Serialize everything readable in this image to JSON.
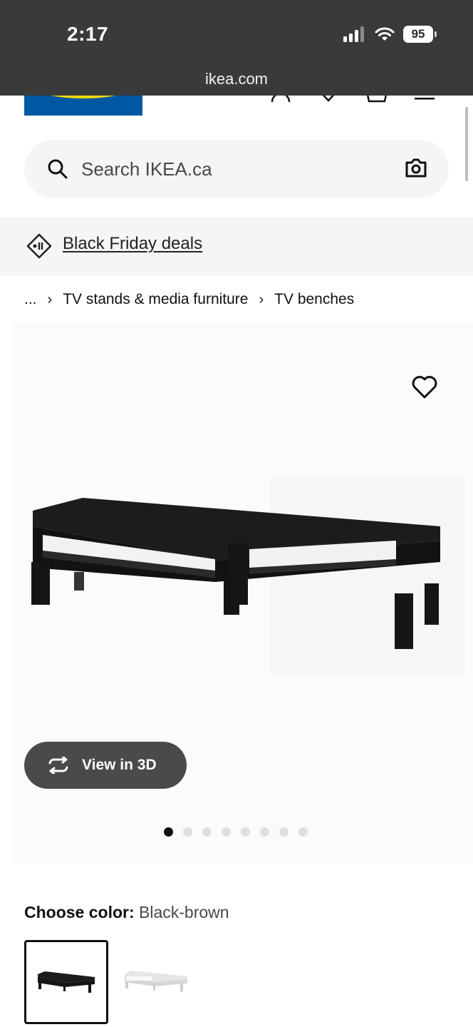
{
  "status_bar": {
    "time": "2:17",
    "battery": "95"
  },
  "browser": {
    "url": "ikea.com"
  },
  "header": {
    "logo_text": "IKEA"
  },
  "search": {
    "placeholder": "Search IKEA.ca"
  },
  "promo": {
    "label": "Black Friday deals"
  },
  "breadcrumb": {
    "ellipsis": "...",
    "items": [
      "TV stands & media furniture",
      "TV benches"
    ],
    "separator": "›"
  },
  "product": {
    "view3d_label": "View in 3D",
    "image_count": 8,
    "active_image": 1
  },
  "color": {
    "label": "Choose color:",
    "value": "Black-brown",
    "options": [
      "Black-brown",
      "White"
    ]
  },
  "colors": {
    "accent_blue": "#0058a3",
    "accent_yellow": "#ffdb00",
    "topbar": "#393b3a"
  }
}
